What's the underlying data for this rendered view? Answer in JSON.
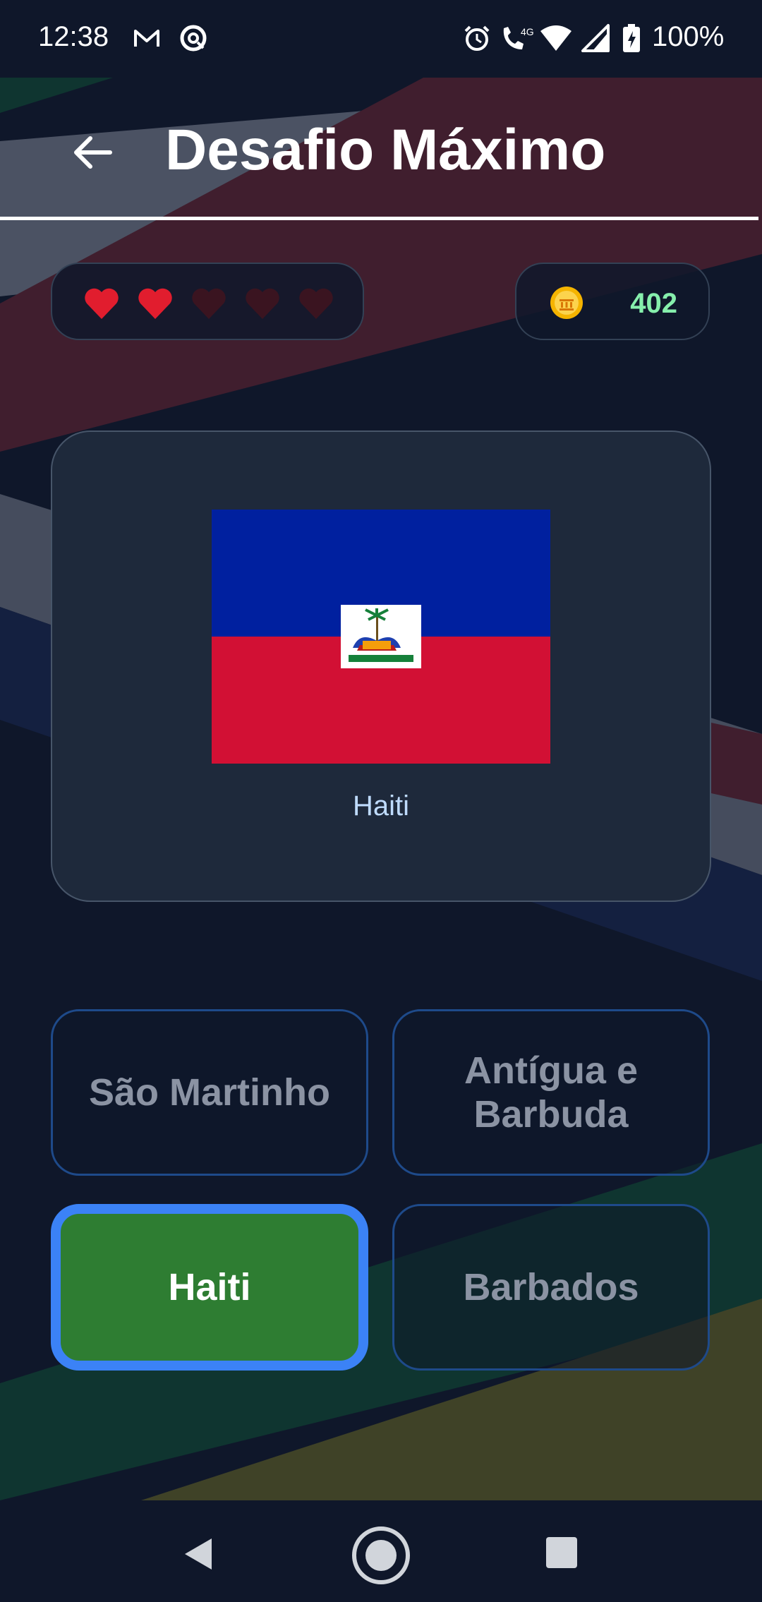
{
  "status_bar": {
    "time": "12:38",
    "battery": "100%",
    "network": "4G"
  },
  "header": {
    "title": "Desafio Máximo"
  },
  "stats": {
    "lives_total": 5,
    "lives_remaining": 2,
    "coins": "402"
  },
  "question": {
    "flag_icon": "haiti-flag",
    "caption": "Haiti"
  },
  "answers": [
    {
      "label": "São Martinho",
      "state": "normal"
    },
    {
      "label": "Antígua e Barbuda",
      "state": "normal"
    },
    {
      "label": "Haiti",
      "state": "correct"
    },
    {
      "label": "Barbados",
      "state": "normal"
    }
  ],
  "colors": {
    "background": "#0f172a",
    "card": "#1e293b",
    "correct": "#2e7d32",
    "selected_border": "#3b82f6",
    "coin_text": "#86efac",
    "heart": "#e11d2e"
  }
}
